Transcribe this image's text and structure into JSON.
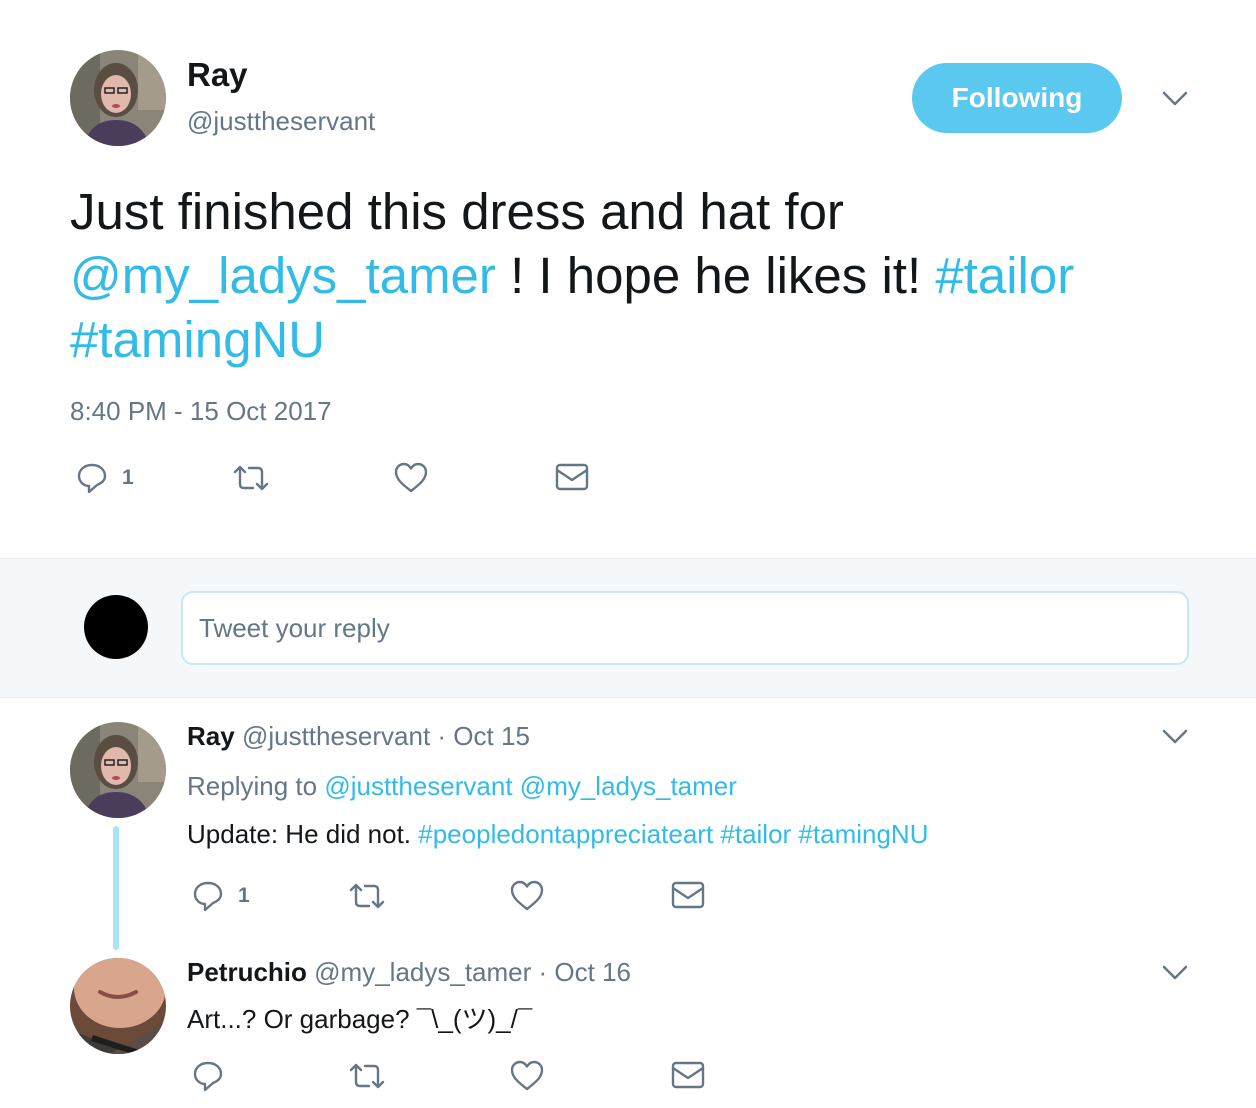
{
  "tweet": {
    "author_name": "Ray",
    "author_handle": "@justtheservant",
    "follow_label": "Following",
    "text_part1": "Just finished this dress and hat for",
    "mention": "@my_ladys_tamer",
    "text_part2": " ! I hope he likes it! ",
    "hashtag1": "#tailor",
    "hashtag2": "#tamingNU",
    "timestamp": "8:40 PM - 15 Oct 2017",
    "reply_count": "1",
    "icons": [
      "reply-icon",
      "retweet-icon",
      "like-icon",
      "message-icon",
      "chevron-down-icon"
    ]
  },
  "reply_box": {
    "placeholder": "Tweet your reply"
  },
  "replies": [
    {
      "name": "Ray",
      "handle": "@justtheservant",
      "date": " · Oct 15",
      "replying_label": "Replying to ",
      "replying_mentions": "@justtheservant @my_ladys_tamer",
      "text": "Update: He did not. ",
      "hashtags": "#peopledontappreciateart #tailor #tamingNU",
      "reply_count": "1"
    },
    {
      "name": "Petruchio",
      "handle": "@my_ladys_tamer",
      "date": " · Oct 16",
      "text": "Art...? Or garbage? ¯\\_(ツ)_/¯",
      "reply_count": ""
    }
  ],
  "colors": {
    "accent": "#33bbe8",
    "follow_button": "#5bc9ef",
    "secondary_text": "#657786",
    "reply_bar_bg": "#f5f8fa",
    "thread_line": "#a9e3f7"
  }
}
